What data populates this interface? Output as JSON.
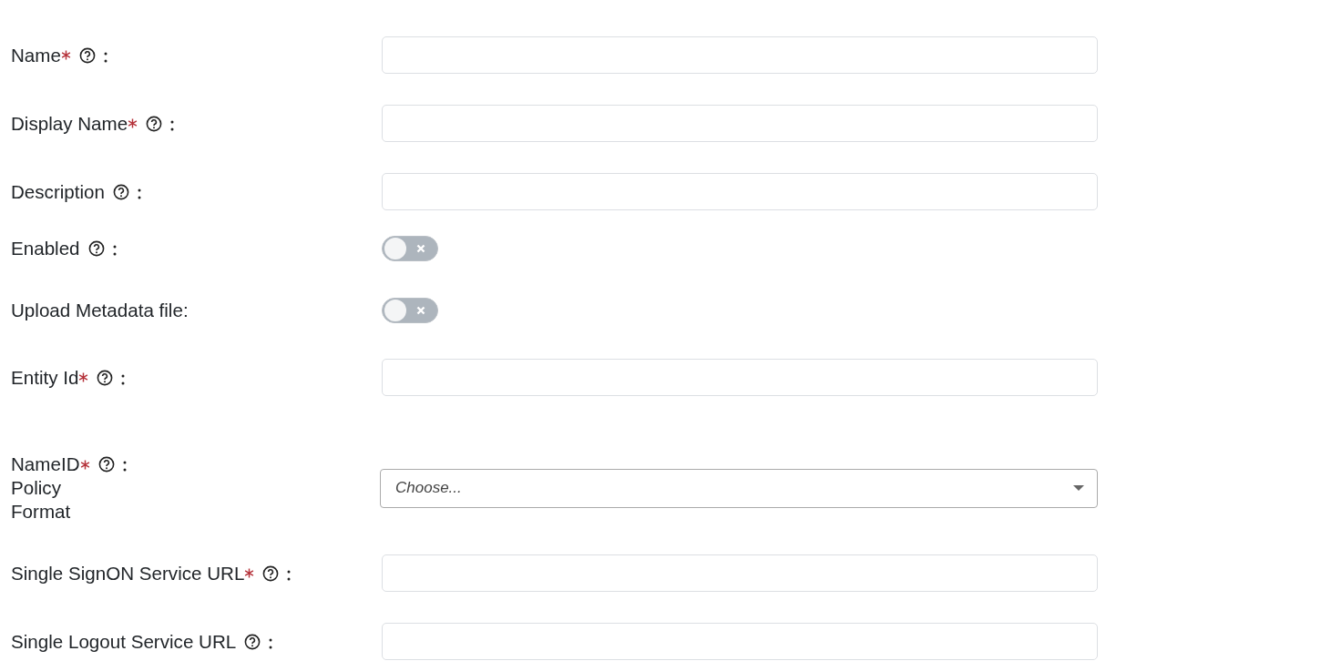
{
  "form": {
    "fields": [
      {
        "kind": "text",
        "label": "Name",
        "required": true,
        "help": true,
        "colon": true
      },
      {
        "kind": "text",
        "label": "Display Name",
        "required": true,
        "help": true,
        "colon": true
      },
      {
        "kind": "text",
        "label": "Description",
        "required": false,
        "help": true,
        "colon": true
      },
      {
        "kind": "toggle",
        "label": "Enabled",
        "required": false,
        "help": true,
        "colon": true,
        "on": false
      },
      {
        "kind": "toggle",
        "label": "Upload Metadata file:",
        "required": false,
        "help": false,
        "colon": false,
        "on": false
      },
      {
        "kind": "text",
        "label": "Entity Id",
        "required": true,
        "help": true,
        "colon": true
      },
      {
        "kind": "select",
        "label": "NameID",
        "label_continuation": [
          "Policy",
          "Format"
        ],
        "required": true,
        "help": true,
        "colon": true,
        "placeholder": "Choose..."
      },
      {
        "kind": "text",
        "label": "Single SignON Service URL",
        "required": true,
        "help": true,
        "colon": true
      },
      {
        "kind": "text",
        "label": "Single Logout Service URL",
        "required": false,
        "help": true,
        "colon": true
      }
    ]
  }
}
